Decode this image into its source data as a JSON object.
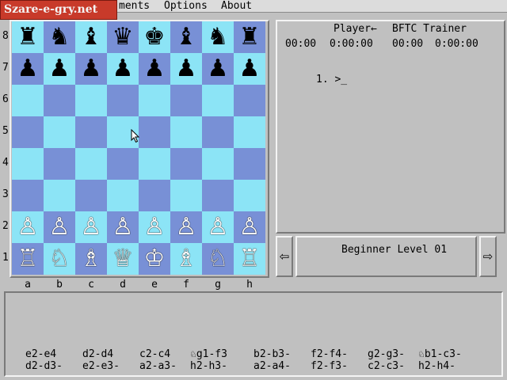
{
  "logo_text": "Szare-e-gry.net",
  "menu": [
    "ments",
    "Options",
    "About"
  ],
  "board": {
    "ranks": [
      "8",
      "7",
      "6",
      "5",
      "4",
      "3",
      "2",
      "1"
    ],
    "files": [
      "a",
      "b",
      "c",
      "d",
      "e",
      "f",
      "g",
      "h"
    ],
    "colors": {
      "light": "#8ce4f6",
      "dark": "#7890d6"
    },
    "position": [
      [
        "♜",
        "♞",
        "♝",
        "♛",
        "♚",
        "♝",
        "♞",
        "♜"
      ],
      [
        "♟",
        "♟",
        "♟",
        "♟",
        "♟",
        "♟",
        "♟",
        "♟"
      ],
      [
        "",
        "",
        "",
        "",
        "",
        "",
        "",
        ""
      ],
      [
        "",
        "",
        "",
        "",
        "",
        "",
        "",
        ""
      ],
      [
        "",
        "",
        "",
        "",
        "",
        "",
        "",
        ""
      ],
      [
        "",
        "",
        "",
        "",
        "",
        "",
        "",
        ""
      ],
      [
        "♙",
        "♙",
        "♙",
        "♙",
        "♙",
        "♙",
        "♙",
        "♙"
      ],
      [
        "♖",
        "♘",
        "♗",
        "♕",
        "♔",
        "♗",
        "♘",
        "♖"
      ]
    ]
  },
  "clock": {
    "player_label": "Player←",
    "opponent_label": "BFTC Trainer",
    "player_time_1": "00:00",
    "player_time_2": "0:00:00",
    "opponent_time_1": "00:00",
    "opponent_time_2": "0:00:00"
  },
  "move_prompt": "1. >_",
  "level": {
    "label": "Beginner Level 01",
    "prev_icon": "left-arrow-icon",
    "next_icon": "right-arrow-icon"
  },
  "suggested_moves": {
    "row1": [
      "e2-e4",
      "d2-d4",
      "c2-c4",
      "♘g1-f3",
      "b2-b3-",
      "f2-f4-",
      "g2-g3-",
      "♘b1-c3-"
    ],
    "row2": [
      "d2-d3-",
      "e2-e3-",
      "a2-a3-",
      "h2-h3-",
      "a2-a4-",
      "f2-f3-",
      "c2-c3-",
      "h2-h4-"
    ]
  }
}
